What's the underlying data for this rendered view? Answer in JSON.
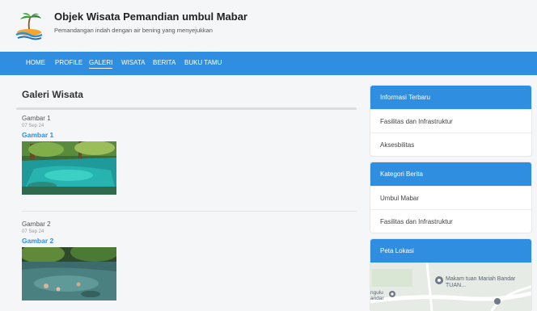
{
  "site": {
    "title": "Objek Wisata Pemandian umbul Mabar",
    "tagline": "Pemandangan indah dengan air bening yang menyejukkan"
  },
  "nav": {
    "items": [
      "HOME",
      "PROFILE",
      "GALERI",
      "WISATA",
      "BERITA",
      "BUKU TAMU"
    ],
    "active": "GALERI"
  },
  "main": {
    "title": "Galeri Wisata",
    "items": [
      {
        "caption": "Gambar 1",
        "date": "07 Sep 24",
        "link": "Gambar 1"
      },
      {
        "caption": "Gambar 2",
        "date": "07 Sep 24",
        "link": "Gambar 2"
      }
    ]
  },
  "sidebar": {
    "latest": {
      "title": "Informasi Terbaru",
      "items": [
        "Fasilitas dan Infrastruktur",
        "Aksesbilitas"
      ]
    },
    "categories": {
      "title": "Kategori Berita",
      "items": [
        "Umbul Mabar",
        "Fasilitas dan Infrastruktur"
      ]
    },
    "map": {
      "title": "Peta Lokasi",
      "place_label": "Makam tuan Mariah Bandar TUAN...",
      "left_label": "ngulu andar"
    }
  },
  "colors": {
    "accent": "#2f8ee0",
    "background": "#f4f6f8"
  }
}
